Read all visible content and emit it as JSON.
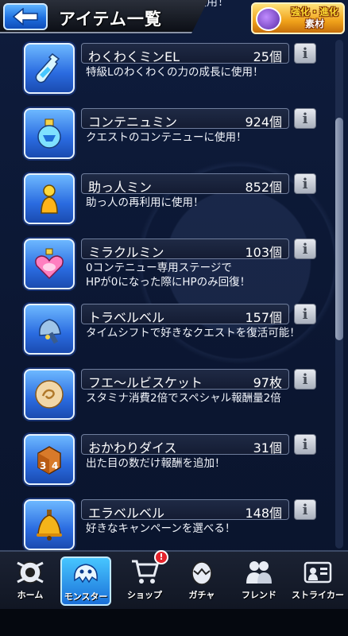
{
  "header": {
    "title": "アイテム一覧",
    "clipped_text": "わくわくの力の成長に使用！",
    "evolve_button_line1": "強化・進化",
    "evolve_button_line2": "素材"
  },
  "items": [
    {
      "name": "わくわくミンEL",
      "count": "25個",
      "desc": "特級Lのわくわくの力の成長に使用！",
      "icon": "bottle-icon"
    },
    {
      "name": "コンテニュミン",
      "count": "924個",
      "desc": "クエストのコンテニューに使用！",
      "icon": "potion-icon"
    },
    {
      "name": "助っ人ミン",
      "count": "852個",
      "desc": "助っ人の再利用に使用！",
      "icon": "helper-icon"
    },
    {
      "name": "ミラクルミン",
      "count": "103個",
      "desc": "0コンテニュー専用ステージで\nHPが0になった際にHPのみ回復！",
      "icon": "heart-potion-icon"
    },
    {
      "name": "トラベルベル",
      "count": "157個",
      "desc": "タイムシフトで好きなクエストを復活可能！",
      "icon": "hand-bell-icon"
    },
    {
      "name": "フエ〜ルビスケット",
      "count": "97枚",
      "desc": "スタミナ消費2倍でスペシャル報酬量2倍",
      "icon": "biscuit-icon"
    },
    {
      "name": "おかわりダイス",
      "count": "31個",
      "desc": "出た目の数だけ報酬を追加！",
      "icon": "dice-icon"
    },
    {
      "name": "エラベルベル",
      "count": "148個",
      "desc": "好きなキャンペーンを選べる！",
      "icon": "gold-bell-icon"
    }
  ],
  "nav": [
    {
      "label": "ホーム",
      "icon": "home-icon"
    },
    {
      "label": "モンスター",
      "icon": "monster-icon",
      "active": true
    },
    {
      "label": "ショップ",
      "icon": "cart-icon",
      "badge": "!"
    },
    {
      "label": "ガチャ",
      "icon": "egg-icon"
    },
    {
      "label": "フレンド",
      "icon": "friends-icon"
    },
    {
      "label": "ストライカー",
      "icon": "striker-icon"
    }
  ],
  "colors": {
    "accent_blue": "#2a6be0",
    "gold": "#f0a21a",
    "badge_red": "#e4232b"
  }
}
